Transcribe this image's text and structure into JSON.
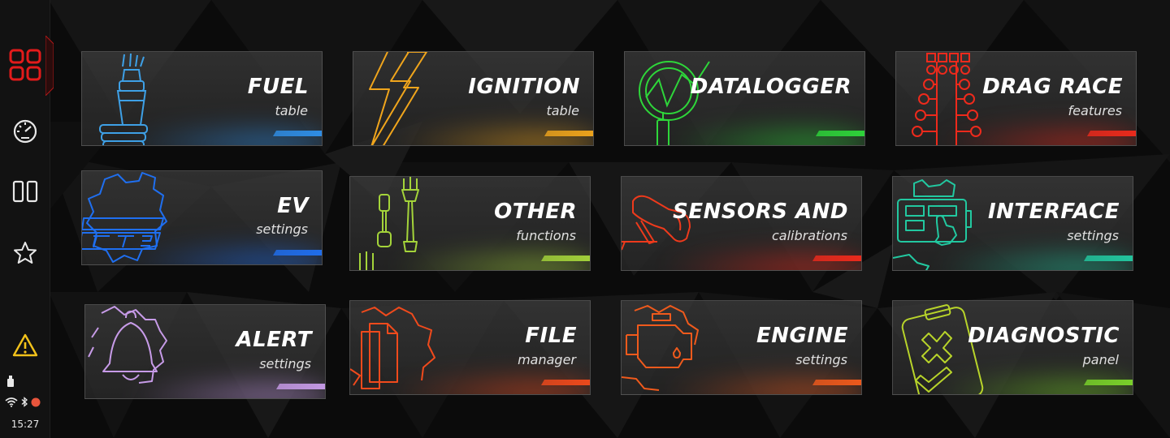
{
  "sidebar": {
    "items": [
      {
        "name": "grid-icon",
        "active": true
      },
      {
        "name": "gauge-icon",
        "active": false
      },
      {
        "name": "dual-panel-icon",
        "active": false
      },
      {
        "name": "star-icon",
        "active": false
      }
    ],
    "warning_icon": "warning-icon",
    "status": {
      "usb_icon": "usb-icon",
      "wifi_icon": "wifi-icon",
      "bluetooth_icon": "bluetooth-icon",
      "record_dot_color": "#e8553c",
      "time": "15:27"
    }
  },
  "tiles": [
    {
      "id": "fuel",
      "title": "FUEL",
      "subtitle": "table",
      "accent": "#2f8fe8",
      "icon": "fuel-injector-icon"
    },
    {
      "id": "ignition",
      "title": "IGNITION",
      "subtitle": "table",
      "accent": "#f0a51c",
      "icon": "lightning-bolt-icon"
    },
    {
      "id": "datalogger",
      "title": "DATALOGGER",
      "subtitle": "",
      "accent": "#2ed63a",
      "icon": "magnifier-graph-icon"
    },
    {
      "id": "drag-race",
      "title": "DRAG RACE",
      "subtitle": "features",
      "accent": "#ee2a1c",
      "icon": "drag-tree-icon"
    },
    {
      "id": "ev",
      "title": "EV",
      "subtitle": "settings",
      "accent": "#1f6ff0",
      "icon": "fte-logo-icon"
    },
    {
      "id": "other",
      "title": "OTHER",
      "subtitle": "functions",
      "accent": "#a4d43a",
      "icon": "tools-icon"
    },
    {
      "id": "sensors",
      "title": "SENSORS AND",
      "subtitle": "calibrations",
      "accent": "#ee2a1c",
      "icon": "pedal-foot-icon"
    },
    {
      "id": "interface",
      "title": "INTERFACE",
      "subtitle": "settings",
      "accent": "#22c8a0",
      "icon": "touch-dash-icon"
    },
    {
      "id": "alert",
      "title": "ALERT",
      "subtitle": "settings",
      "accent": "#c79be8",
      "icon": "bell-gear-icon"
    },
    {
      "id": "file",
      "title": "FILE",
      "subtitle": "manager",
      "accent": "#f04a1c",
      "icon": "file-gear-icon"
    },
    {
      "id": "engine",
      "title": "ENGINE",
      "subtitle": "settings",
      "accent": "#f05a1c",
      "icon": "engine-gear-icon"
    },
    {
      "id": "diagnostic",
      "title": "DIAGNOSTIC",
      "subtitle": "panel",
      "accent": "#7bd42a",
      "icon": "clipboard-check-icon"
    }
  ]
}
